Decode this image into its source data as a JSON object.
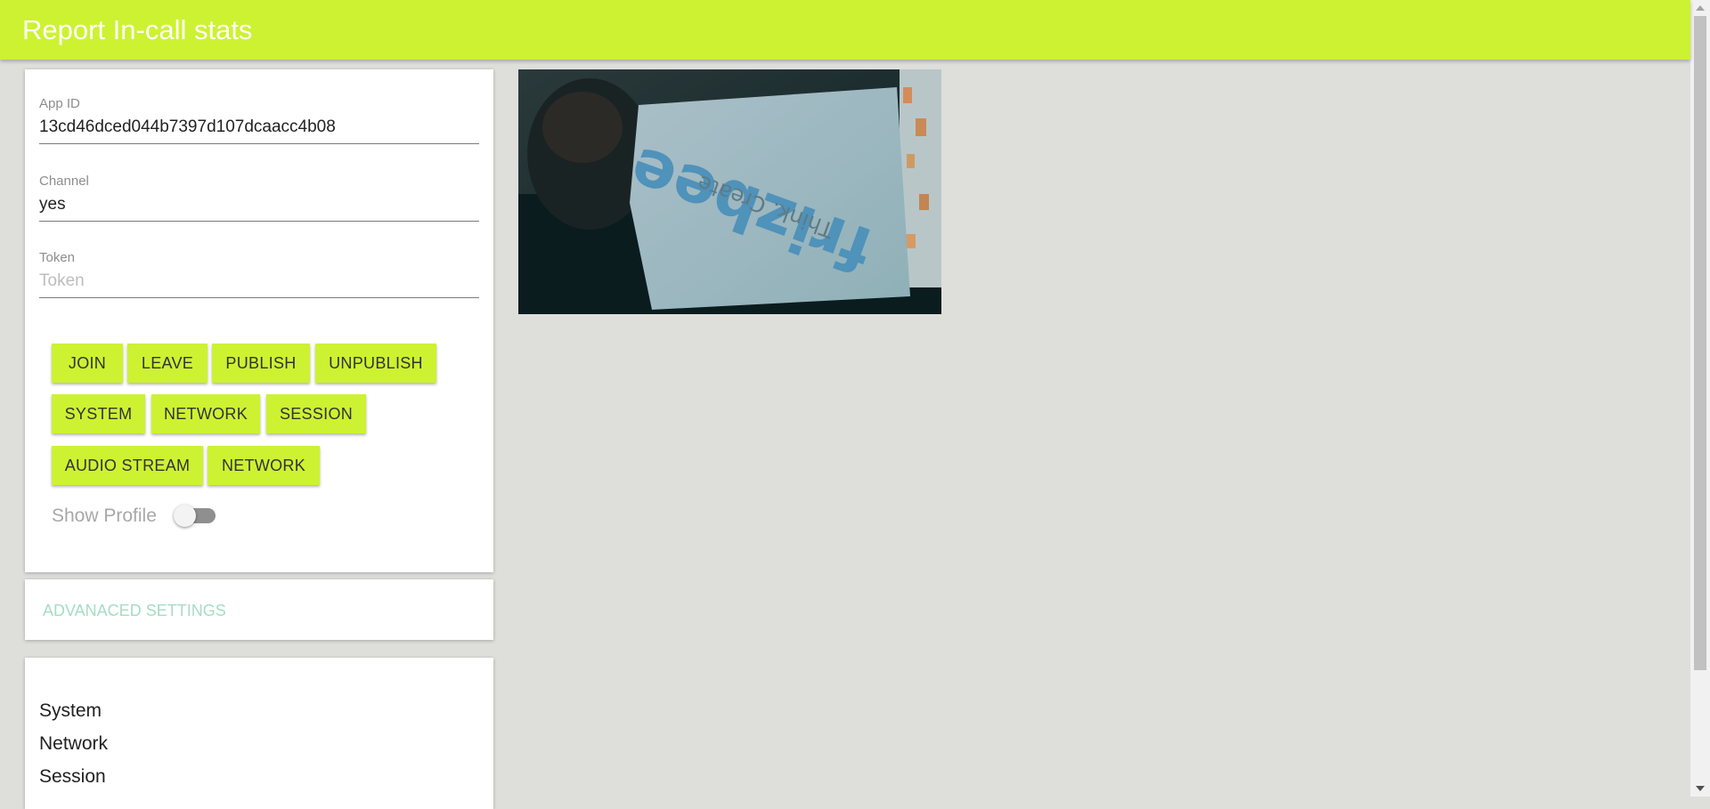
{
  "header": {
    "title": "Report In-call stats"
  },
  "form": {
    "app_id": {
      "label": "App ID",
      "value": "13cd46dced044b7397d107dcaacc4b08"
    },
    "channel": {
      "label": "Channel",
      "value": "yes"
    },
    "token": {
      "label": "Token",
      "value": "",
      "placeholder": "Token"
    }
  },
  "buttons": {
    "join": "JOIN",
    "leave": "LEAVE",
    "publish": "PUBLISH",
    "unpublish": "UNPUBLISH",
    "system": "SYSTEM",
    "network": "NETWORK",
    "session": "SESSION",
    "audio_stream": "AUDIO STREAM",
    "network2": "NETWORK"
  },
  "show_profile": {
    "label": "Show Profile",
    "checked": false
  },
  "advanced": {
    "label": "ADVANACED SETTINGS"
  },
  "stats": {
    "items": [
      "System",
      "Network",
      "Session"
    ]
  },
  "video": {
    "overlay_text": "frizbee",
    "overlay_subtext": "Think. Create"
  },
  "colors": {
    "accent": "#cdf231",
    "background": "#dededa",
    "advanced_text": "#a6dcc7"
  },
  "icons": {
    "toggle": "switch-toggle-icon",
    "scroll_up": "scroll-up-arrow-icon",
    "scroll_down": "scroll-down-arrow-icon"
  }
}
